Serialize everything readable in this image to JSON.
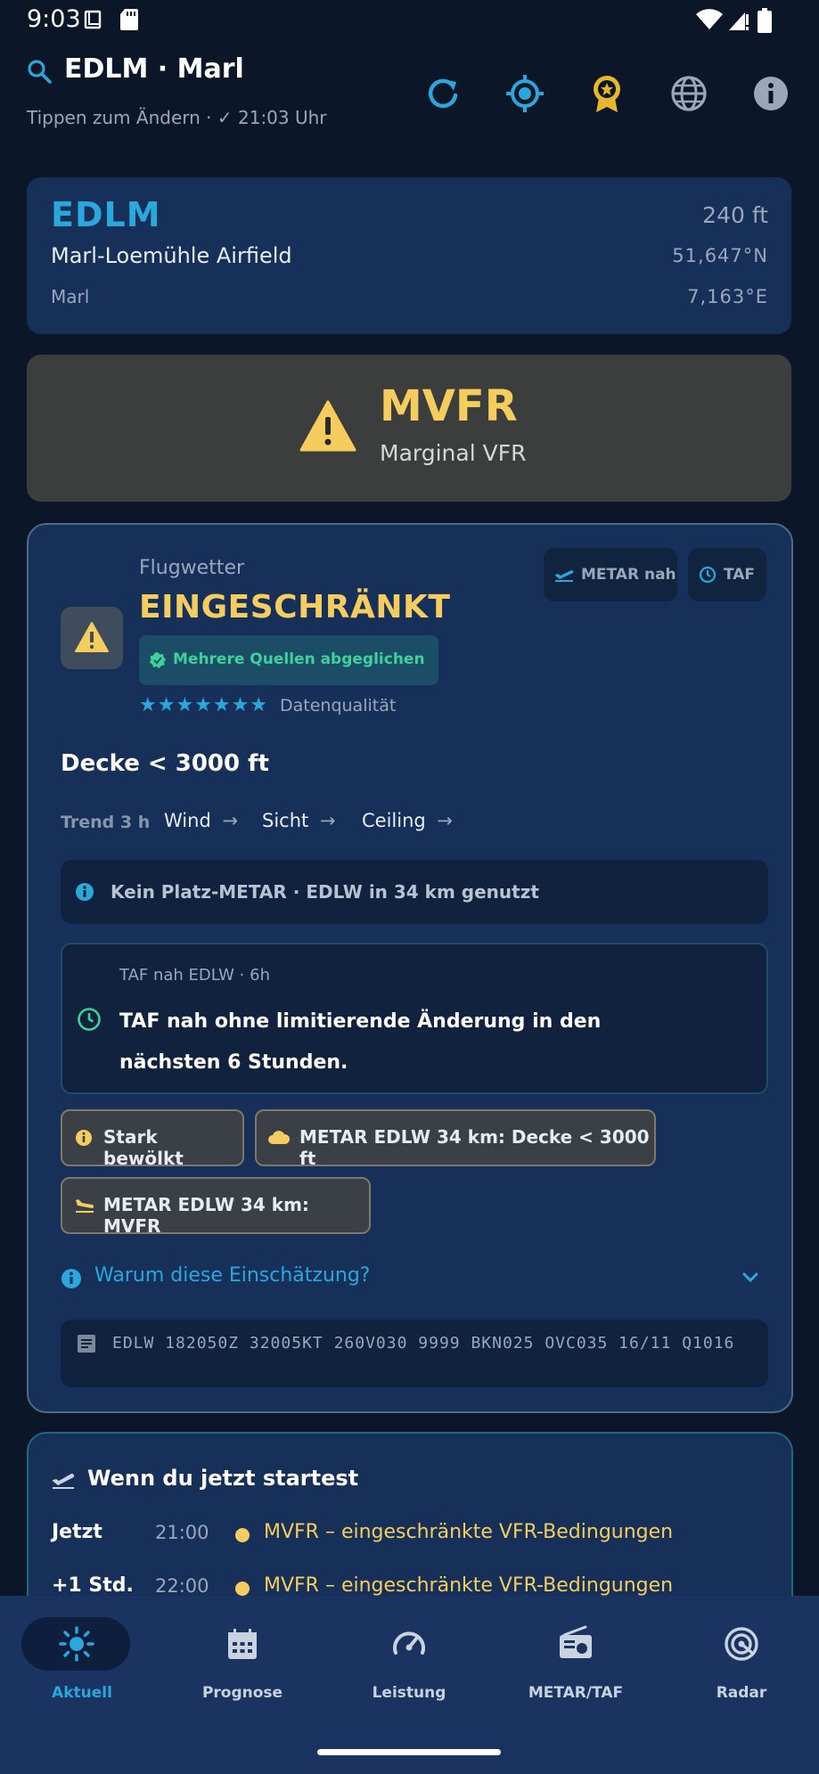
{
  "status_bar": {
    "time": "9:03"
  },
  "header": {
    "title": "EDLM · Marl",
    "subtitle": "Tippen zum Ändern · ✓ 21:03 Uhr"
  },
  "airport": {
    "code": "EDLM",
    "elevation": "240 ft",
    "name": "Marl-Loemühle Airfield",
    "lat": "51,647°N",
    "city": "Marl",
    "lon": "7,163°E"
  },
  "category": {
    "code": "MVFR",
    "description": "Marginal VFR"
  },
  "flight_weather": {
    "label": "Flugwetter",
    "state": "EINGESCHRÄNKT",
    "source_badge": "Mehrere Quellen abgeglichen",
    "stars": "★★★★★★★",
    "quality_label": "Datenqualität",
    "chip_metar": "METAR nah",
    "chip_taf": "TAF",
    "ceiling": "Decke < 3000 ft",
    "trend": {
      "label": "Trend 3 h",
      "wind": "Wind",
      "sight": "Sicht",
      "ceiling": "Ceiling",
      "arrow": "→"
    },
    "info_note": "Kein Platz-METAR · EDLW in 34 km genutzt",
    "taf": {
      "heading": "TAF nah EDLW · 6h",
      "text": "TAF nah ohne limitierende Änderung in den nächsten 6 Stunden."
    },
    "chips": [
      "Stark bewölkt",
      "METAR EDLW 34 km: Decke < 3000 ft",
      "METAR EDLW 34 km: MVFR"
    ],
    "why_label": "Warum diese Einschätzung?",
    "metar_raw": "EDLW 182050Z 32005KT 260V030 9999 BKN025 OVC035 16/11 Q1016"
  },
  "takeoff": {
    "title": "Wenn du jetzt startest",
    "rows": [
      {
        "label": "Jetzt",
        "time": "21:00",
        "text": "MVFR – eingeschränkte VFR-Bedingungen"
      },
      {
        "label": "+1 Std.",
        "time": "22:00",
        "text": "MVFR – eingeschränkte VFR-Bedingungen"
      }
    ]
  },
  "nav": {
    "items": [
      {
        "label": "Aktuell"
      },
      {
        "label": "Prognose"
      },
      {
        "label": "Leistung"
      },
      {
        "label": "METAR/TAF"
      },
      {
        "label": "Radar"
      }
    ]
  },
  "colors": {
    "background": "#0c1629",
    "card": "#17305a",
    "accent": "#2aa7db",
    "mvfr": "#f5cd5e",
    "green": "#3ed19c"
  }
}
